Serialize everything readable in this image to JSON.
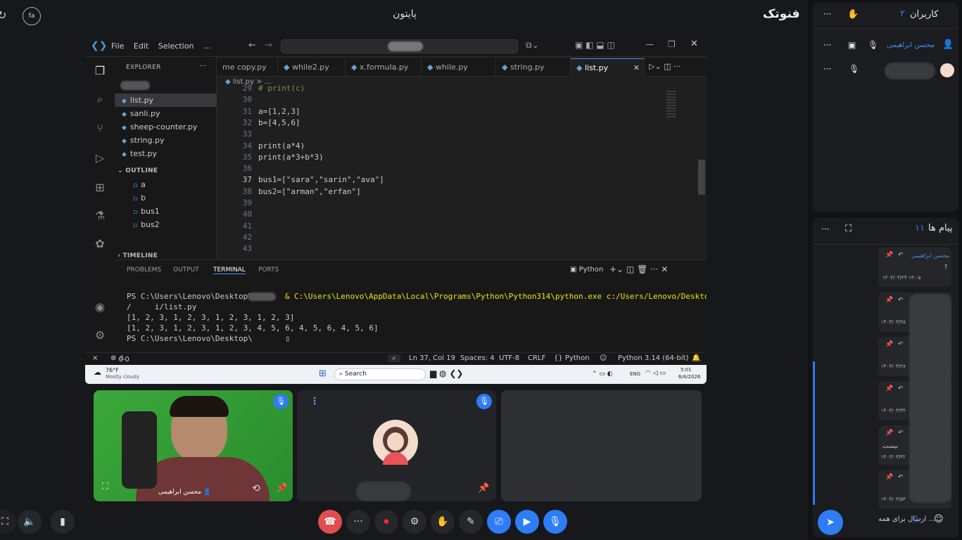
{
  "meeting": {
    "title": "پایتون",
    "brand": "فنوتک",
    "lang": "fa"
  },
  "vscode": {
    "menu": [
      "File",
      "Edit",
      "Selection",
      "..."
    ],
    "explorer_title": "EXPLORER",
    "files": [
      "list.py",
      "sanli.py",
      "sheep-counter.py",
      "string.py",
      "test.py"
    ],
    "outline_title": "OUTLINE",
    "outline": [
      "a",
      "b",
      "bus1",
      "bus2"
    ],
    "timeline_title": "TIMELINE",
    "tabs": [
      "me copy.py",
      "while2.py",
      "x.formula.py",
      "while.py",
      "string.py",
      "list.py"
    ],
    "breadcrumb": "list.py > ...",
    "lines": [
      {
        "n": "29",
        "code": "# print(c)"
      },
      {
        "n": "30",
        "code": ""
      },
      {
        "n": "31",
        "code": "a=[1,2,3]"
      },
      {
        "n": "32",
        "code": "b=[4,5,6]"
      },
      {
        "n": "33",
        "code": ""
      },
      {
        "n": "34",
        "code": "print(a*4)"
      },
      {
        "n": "35",
        "code": "print(a*3+b*3)"
      },
      {
        "n": "36",
        "code": ""
      },
      {
        "n": "37",
        "code": "bus1=[\"sara\",\"sarin\",\"ava\"]"
      },
      {
        "n": "38",
        "code": "bus2=[\"arman\",\"erfan\"]"
      },
      {
        "n": "39",
        "code": ""
      },
      {
        "n": "40",
        "code": ""
      },
      {
        "n": "41",
        "code": ""
      },
      {
        "n": "42",
        "code": ""
      },
      {
        "n": "43",
        "code": ""
      }
    ],
    "panel_tabs": [
      "PROBLEMS",
      "OUTPUT",
      "TERMINAL",
      "PORTS"
    ],
    "terminal_shell": "Python",
    "terminal": [
      "PS C:\\Users\\Lenovo\\Desktop\\",
      "& C:\\Users\\Lenovo\\AppData\\Local\\Programs\\Python\\Python314\\python.exe c:/Users/Lenovo/Desktop",
      "/     i/list.py",
      "[1, 2, 3, 1, 2, 3, 1, 2, 3, 1, 2, 3]",
      "[1, 2, 3, 1, 2, 3, 1, 2, 3, 4, 5, 6, 4, 5, 6, 4, 5, 6]",
      "PS C:\\Users\\Lenovo\\Desktop\\"
    ],
    "status": {
      "errors": "0",
      "warnings": "0",
      "cursor": "Ln 37, Col 19",
      "spaces": "Spaces: 4",
      "encoding": "UTF-8",
      "eol": "CRLF",
      "lang": "{} Python",
      "interpreter": "Python 3.14 (64-bit)"
    },
    "taskbar": {
      "weather": "76°F",
      "weather_desc": "Mostly cloudy",
      "search": "Search",
      "lang": "ENG",
      "time": "5:01",
      "date": "6/4/2026"
    }
  },
  "tiles": {
    "user1_name": "محسن ابراهیمی"
  },
  "users_panel": {
    "title": "کاربران",
    "count": "۲",
    "user1": "محسن ابراهیمی"
  },
  "messages_panel": {
    "title": "پیام ها",
    "count": "۱۱",
    "first_sender": "محسن ابراهیمی",
    "first_text": "؟",
    "first_time": "۱۴۰۳/۰۳/۲۳ ۱۴:۰۵",
    "text_5": "نیست",
    "times": [
      "۱۴۰۳/۰۳/۲۵",
      "۱۴۰۳/۰۳/۲۸",
      "۱۴۰۳/۰۳/۳۴",
      "۱۴۰۳/۰۳/۴۲",
      "۱۴۰۳/۰۳/۵۳"
    ],
    "input_placeholder": "ارسال برای همه ..."
  }
}
